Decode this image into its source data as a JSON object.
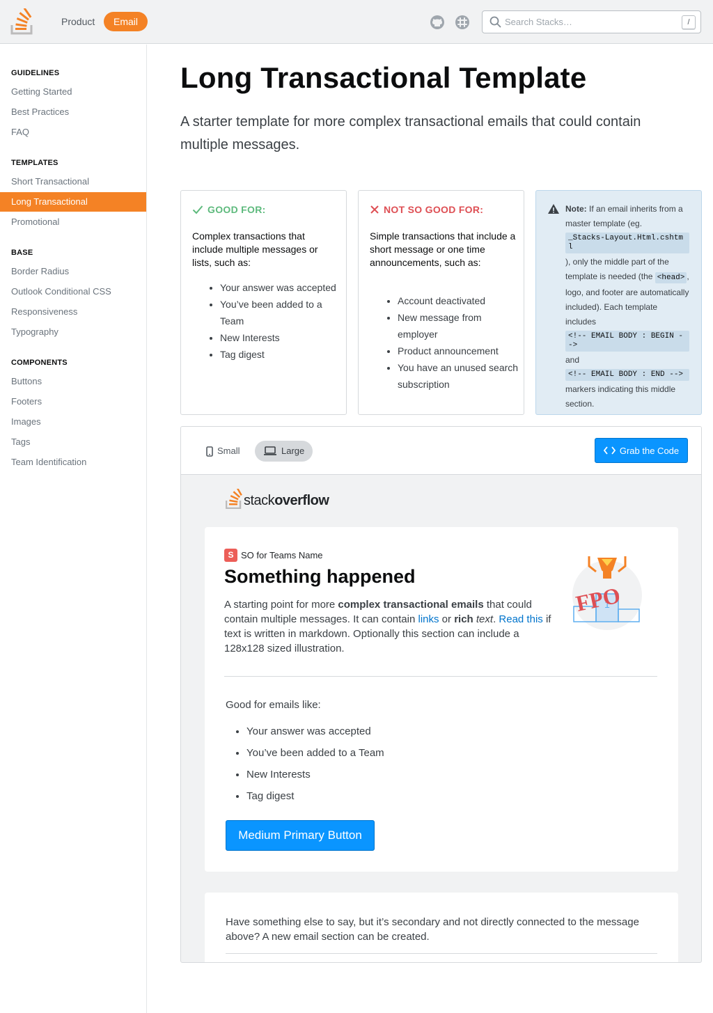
{
  "header": {
    "nav_product": "Product",
    "nav_email": "Email",
    "search_placeholder": "Search Stacks…",
    "search_shortcut": "/",
    "accent": "#f48225"
  },
  "sidebar": {
    "sections": [
      {
        "heading": "GUIDELINES",
        "items": [
          "Getting Started",
          "Best Practices",
          "FAQ"
        ]
      },
      {
        "heading": "TEMPLATES",
        "items": [
          "Short Transactional",
          "Long Transactional",
          "Promotional"
        ]
      },
      {
        "heading": "BASE",
        "items": [
          "Border Radius",
          "Outlook Conditional CSS",
          "Responsiveness",
          "Typography"
        ]
      },
      {
        "heading": "COMPONENTS",
        "items": [
          "Buttons",
          "Footers",
          "Images",
          "Tags",
          "Team Identification"
        ]
      }
    ],
    "active_item": "Long Transactional"
  },
  "page": {
    "title": "Long Transactional Template",
    "lead": "A starter template for more complex transactional emails that could contain multiple messages."
  },
  "good_for": {
    "heading": "GOOD FOR:",
    "text": "Complex transactions that include multiple messages or lists, such as:",
    "items": [
      "Your answer was accepted",
      "You’ve been added to a Team",
      "New Interests",
      "Tag digest"
    ],
    "color": "#5eba7d"
  },
  "not_good_for": {
    "heading": "NOT SO GOOD FOR:",
    "text": "Simple transactions that include a short message or one time announcements, such as:",
    "items": [
      "Account deactivated",
      "New message from employer",
      "Product announcement",
      "You have an unused search subscription"
    ],
    "color": "#de4f54"
  },
  "note": {
    "label": "Note:",
    "t1": "If an email inherits from a master template (eg.",
    "code1": "_Stacks-Layout.Html.cshtml",
    "t2": "), only the middle part of the template is needed (the",
    "code2": "<head>",
    "t3": ", logo, and footer are automatically included). Each template includes",
    "code3": "<!-- EMAIL BODY : BEGIN -->",
    "t4": "and",
    "code4": "<!-- EMAIL BODY : END -->",
    "t5": "markers indicating this middle section."
  },
  "preview": {
    "small_label": "Small",
    "large_label": "Large",
    "selected_size": "Large",
    "grab_label": "Grab the Code",
    "logo_text_light": "stack",
    "logo_text_bold": "overflow",
    "email": {
      "team_initial": "S",
      "team_name": "SO for Teams Name",
      "title": "Something happened",
      "p_1": "A starting point for more ",
      "p_2": "complex transactional emails",
      "p_3": " that could contain multiple messages. It can contain ",
      "p_link1": "links",
      "p_4": " or ",
      "p_5": "rich",
      "p_6": " ",
      "p_7": "text",
      "p_8": ". ",
      "p_link2": "Read this",
      "p_9": " if text is written in markdown. Optionally this section can include a 128x128 sized illustration.",
      "fpo_label": "FPO",
      "good_intro": "Good for emails like:",
      "list": [
        "Your answer was accepted",
        "You’ve been added to a Team",
        "New Interests",
        "Tag digest"
      ],
      "button": "Medium Primary Button"
    },
    "email2": {
      "text": "Have something else to say, but it’s secondary and not directly connected to the message above? A new email section can be created."
    }
  }
}
